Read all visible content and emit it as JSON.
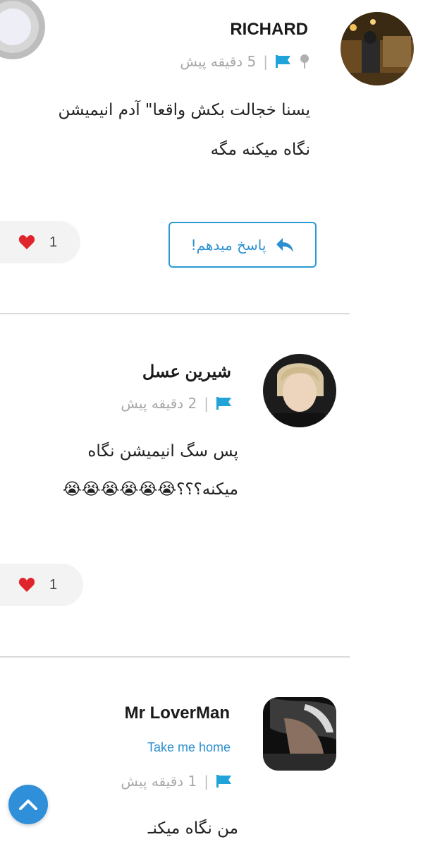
{
  "comments": [
    {
      "author": "RICHARD",
      "time": "5 دقیقه پیش",
      "separator": "|",
      "body_line1": "یسنا خجالت بکش واقعا\" آدم انیمیشن",
      "body_line2": "نگاه میکنه مگه",
      "likes": "1",
      "reply_label": "پاسخ میدهم!"
    },
    {
      "author": "شیرین عسل",
      "time": "2 دقیقه پیش",
      "separator": "|",
      "body_line1": "پس سگ انیمیشن نگاه",
      "body_line2": "میکنه؟؟؟😭😭😭😭😭😭",
      "likes": "1"
    },
    {
      "author": "Mr LoverMan",
      "subtitle": "Take me home",
      "time": "1 دقیقه پیش",
      "separator": "|",
      "body_line1": "من نگاه میکنـ"
    }
  ],
  "colors": {
    "accent": "#2b8fd0",
    "flag": "#1fa3d8",
    "heart": "#e0242c",
    "divider": "#dadada",
    "scroll_button": "#2f8fd9"
  },
  "icons": {
    "flag": "flag-icon",
    "pin": "pin-icon",
    "heart": "heart-icon",
    "reply": "reply-arrow-icon",
    "scroll_top": "chevron-up-icon"
  }
}
